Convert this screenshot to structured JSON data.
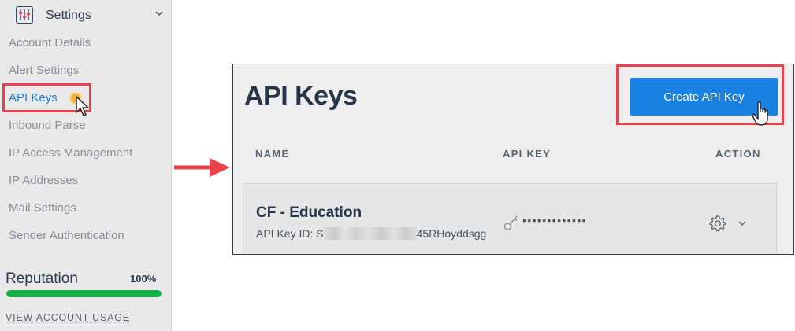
{
  "sidebar": {
    "section_title": "Settings",
    "items": [
      {
        "label": "Account Details"
      },
      {
        "label": "Alert Settings"
      },
      {
        "label": "API Keys",
        "active": true
      },
      {
        "label": "Inbound Parse"
      },
      {
        "label": "IP Access Management"
      },
      {
        "label": "IP Addresses"
      },
      {
        "label": "Mail Settings"
      },
      {
        "label": "Sender Authentication"
      }
    ],
    "reputation": {
      "label": "Reputation",
      "value_text": "100%",
      "value": 1.0
    },
    "view_usage_label": "VIEW ACCOUNT USAGE"
  },
  "main": {
    "title": "API Keys",
    "create_button_label": "Create API Key",
    "columns": [
      "NAME",
      "API KEY",
      "ACTION"
    ],
    "rows": [
      {
        "name": "CF - Education",
        "id_prefix": "API Key ID: S",
        "id_suffix": "45RHoyddsgg",
        "masked_key": "•••••••••••••"
      }
    ]
  },
  "colors": {
    "accent": "#1a82e2",
    "highlight": "#e8434a",
    "reputation_bar": "#17b04d"
  },
  "icons": [
    "settings-sliders-icon",
    "chevron-down-icon",
    "pointer-cursor-icon",
    "hand-cursor-icon",
    "key-icon",
    "gear-icon",
    "arrow-right-icon"
  ]
}
